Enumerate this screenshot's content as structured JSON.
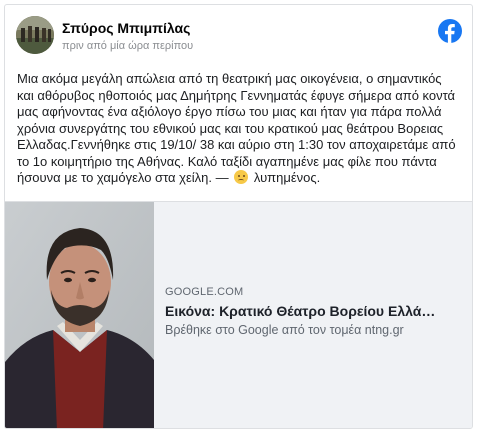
{
  "post": {
    "author": "Σπύρος Μπιμπίλας",
    "time": "πριν από μία ώρα περίπου",
    "logo_icon": "facebook-logo-icon",
    "text_main": "Μια ακόμα μεγάλη απώλεια από τη θεατρική μας οικογένεια, ο σημαντικός και αθόρυβος ηθοποιός μας Δημήτρης Γεννηματάς έφυγε σήμερα από κοντά μας αφήνοντας ένα αξιόλογο έργο πίσω του μιας και ήταν για πάρα πολλά χρόνια συνεργάτης του εθνικού μας και του κρατικού μας θεάτρου Βορειας Ελλαδας.Γεννήθηκε στις 19/10/ 38 και αύριο στη 1:30 τον αποχαιρετάμε από το 1ο κοιμητήριο της Αθήνας. Καλό ταξίδι αγαπημένε μας φίλε που πάντα ήσουνα με το χαμόγελο στα χείλη. —",
    "feeling_icon": "sad-face-emoji-icon",
    "feeling": "λυπημένος."
  },
  "link": {
    "domain": "GOOGLE.COM",
    "title": "Εικόνα: Κρατικό Θέατρο Βορείου Ελλά…",
    "description": "Βρέθηκε στο Google από τον τομέα ntng.gr"
  },
  "colors": {
    "facebook_blue": "#1877f2",
    "card_bg": "#f0f2f5",
    "meta_gray": "#8a8d91"
  }
}
